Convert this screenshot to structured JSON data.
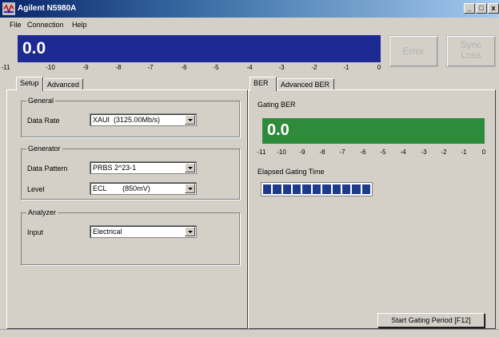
{
  "window": {
    "title": "Agilent N5980A",
    "controls": [
      "_",
      "□",
      "x"
    ]
  },
  "menu": [
    "File",
    "Connection",
    "Help"
  ],
  "main_display": {
    "value": "0.0",
    "color": "#1e2a94",
    "scale": [
      "-11",
      "-10",
      "-9",
      "-8",
      "-7",
      "-6",
      "-5",
      "-4",
      "-3",
      "-2",
      "-1",
      "0"
    ]
  },
  "indicators": {
    "error": "Error",
    "sync_line1": "Sync",
    "sync_line2": "Loss"
  },
  "left_tabs": [
    "Setup",
    "Advanced"
  ],
  "setup": {
    "general": {
      "title": "General",
      "data_rate_label": "Data Rate",
      "data_rate_value": "XAUI  (3125.00Mb/s)"
    },
    "generator": {
      "title": "Generator",
      "pattern_label": "Data Pattern",
      "pattern_value": "PRBS 2^23-1",
      "level_label": "Level",
      "level_value": "ECL        (850mV)"
    },
    "analyzer": {
      "title": "Analyzer",
      "input_label": "Input",
      "input_value": "Electrical"
    }
  },
  "right_tabs": [
    "BER",
    "Advanced BER"
  ],
  "ber": {
    "gating_label": "Gating BER",
    "gating_value": "0.0",
    "gating_color": "#2e8b3a",
    "scale": [
      "-11",
      "-10",
      "-9",
      "-8",
      "-7",
      "-6",
      "-5",
      "-4",
      "-3",
      "-2",
      "-1",
      "0"
    ],
    "elapsed_label": "Elapsed Gating Time",
    "progress_segments": 11,
    "start_button": "Start Gating Period  [F12]"
  }
}
